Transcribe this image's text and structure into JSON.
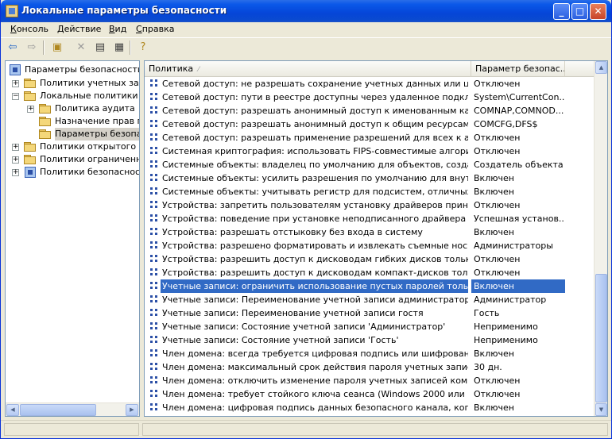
{
  "window": {
    "title": "Локальные параметры безопасности",
    "minimize": "_",
    "maximize": "□",
    "close": "✕"
  },
  "menu": [
    {
      "hot": "К",
      "rest": "онсоль"
    },
    {
      "hot": "Д",
      "rest": "ействие"
    },
    {
      "hot": "В",
      "rest": "ид"
    },
    {
      "hot": "С",
      "rest": "правка"
    }
  ],
  "toolbar": [
    "back-icon",
    "forward-icon",
    "up-folder-icon",
    "delete-icon",
    "properties-icon",
    "export-list-icon",
    "help-icon"
  ],
  "tree": [
    {
      "label": "Параметры безопасности",
      "level": 0,
      "expander": "",
      "icon": "security-settings-icon",
      "selected": false
    },
    {
      "label": "Политики учетных записе",
      "level": 1,
      "expander": "+",
      "icon": "folder-icon",
      "selected": false
    },
    {
      "label": "Локальные политики",
      "level": 1,
      "expander": "−",
      "icon": "folder-icon",
      "selected": false
    },
    {
      "label": "Политика аудита",
      "level": 2,
      "expander": "+",
      "icon": "folder-icon",
      "selected": false
    },
    {
      "label": "Назначение прав пол",
      "level": 2,
      "expander": "",
      "icon": "folder-icon",
      "selected": false
    },
    {
      "label": "Параметры безопасн",
      "level": 2,
      "expander": "",
      "icon": "folder-icon",
      "selected": true
    },
    {
      "label": "Политики открытого клю",
      "level": 1,
      "expander": "+",
      "icon": "folder-icon",
      "selected": false
    },
    {
      "label": "Политики ограниченного",
      "level": 1,
      "expander": "+",
      "icon": "folder-icon",
      "selected": false
    },
    {
      "label": "Политики безопасности ",
      "level": 1,
      "expander": "+",
      "icon": "ip-security-icon",
      "selected": false
    }
  ],
  "columns": {
    "policy": "Политика",
    "setting": "Параметр безопас..."
  },
  "rows": [
    {
      "policy": "Сетевой доступ: не разрешать сохранение учетных данных или цифров...",
      "value": "Отключен"
    },
    {
      "policy": "Сетевой доступ: пути в реестре доступны через удаленное подключение",
      "value": "System\\CurrentCon..."
    },
    {
      "policy": "Сетевой доступ: разрешать анонимный доступ к именованным каналам",
      "value": "COMNAP,COMNOD..."
    },
    {
      "policy": "Сетевой доступ: разрешать анонимный доступ к общим ресурсам",
      "value": "COMCFG,DFS$"
    },
    {
      "policy": "Сетевой доступ: разрешать применение разрешений для всех к аноним...",
      "value": "Отключен"
    },
    {
      "policy": "Системная криптография: использовать FIPS-совместимые алгоритмы д...",
      "value": "Отключен"
    },
    {
      "policy": "Системные объекты: владелец по умолчанию для объектов, созданных...",
      "value": "Создатель объекта"
    },
    {
      "policy": "Системные объекты: усилить разрешения по умолчанию для внутренни...",
      "value": "Включен"
    },
    {
      "policy": "Системные объекты: учитывать регистр для подсистем, отличных от ...",
      "value": "Включен"
    },
    {
      "policy": "Устройства: запретить пользователям установку драйверов принтера",
      "value": "Отключен"
    },
    {
      "policy": "Устройства: поведение при установке неподписанного драйвера",
      "value": "Успешная установ..."
    },
    {
      "policy": "Устройства: разрешать отстыковку без входа в систему",
      "value": "Включен"
    },
    {
      "policy": "Устройства: разрешено форматировать и извлекать съемные носители",
      "value": "Администраторы"
    },
    {
      "policy": "Устройства: разрешить доступ к дисководам гибких дисков только лок...",
      "value": "Отключен"
    },
    {
      "policy": "Устройства: разрешить доступ к дисководам компакт-дисков только лок...",
      "value": "Отключен"
    },
    {
      "policy": "Учетные записи: ограничить использование пустых паролей только дл...",
      "value": "Включен",
      "selected": true
    },
    {
      "policy": "Учетные записи: Переименование учетной записи администратора",
      "value": "Администратор"
    },
    {
      "policy": "Учетные записи: Переименование учетной записи гостя",
      "value": "Гость"
    },
    {
      "policy": "Учетные записи: Состояние учетной записи 'Администратор'",
      "value": "Непримениmo"
    },
    {
      "policy": "Учетные записи: Состояние учетной записи 'Гость'",
      "value": "Неприменимо"
    },
    {
      "policy": "Член домена: всегда требуется цифровая подпись или шифрование пот...",
      "value": "Включен"
    },
    {
      "policy": "Член домена: максимальный срок действия пароля учетных записей ко...",
      "value": "30 дн."
    },
    {
      "policy": "Член домена: отключить изменение пароля учетных записей компьютера",
      "value": "Отключен"
    },
    {
      "policy": "Член домена: требует стойкого ключа сеанса (Windows 2000 или выше)",
      "value": "Отключен"
    },
    {
      "policy": "Член домена: цифровая подпись данных безопасного канала, когда это...",
      "value": "Включен"
    }
  ],
  "colors": {
    "title_bar": "#0a58e8",
    "selection": "#316ac5",
    "chrome": "#ece9d8"
  }
}
